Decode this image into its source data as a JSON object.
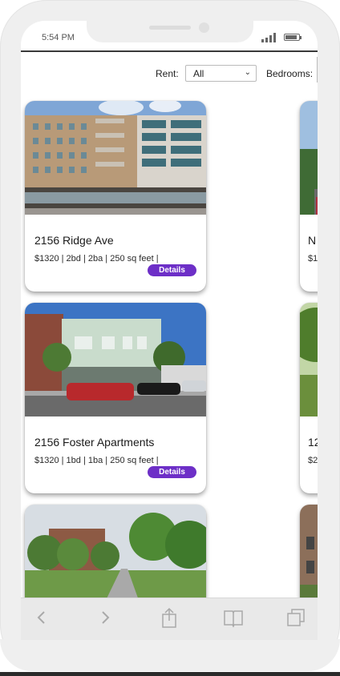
{
  "status": {
    "time": "5:54 PM"
  },
  "filters": {
    "rent_label": "Rent:",
    "rent_value": "All",
    "bedrooms_label": "Bedrooms:"
  },
  "listings": [
    {
      "title": "2156 Ridge Ave",
      "meta": "$1320 | 2bd | 2ba | 250 sq feet |",
      "button": "Details"
    },
    {
      "title": "2156 Foster Apartments",
      "meta": "$1320 | 1bd | 1ba | 250 sq feet |",
      "button": "Details"
    }
  ],
  "peek_listings": [
    {
      "title": "N",
      "meta": "$1"
    },
    {
      "title": "12",
      "meta": "$2"
    }
  ],
  "toolbar": {
    "back_icon": "chevron-left-icon",
    "forward_icon": "chevron-right-icon",
    "share_icon": "share-icon",
    "bookmarks_icon": "book-icon",
    "tabs_icon": "tabs-icon"
  },
  "colors": {
    "accent": "#6d2fc7"
  }
}
